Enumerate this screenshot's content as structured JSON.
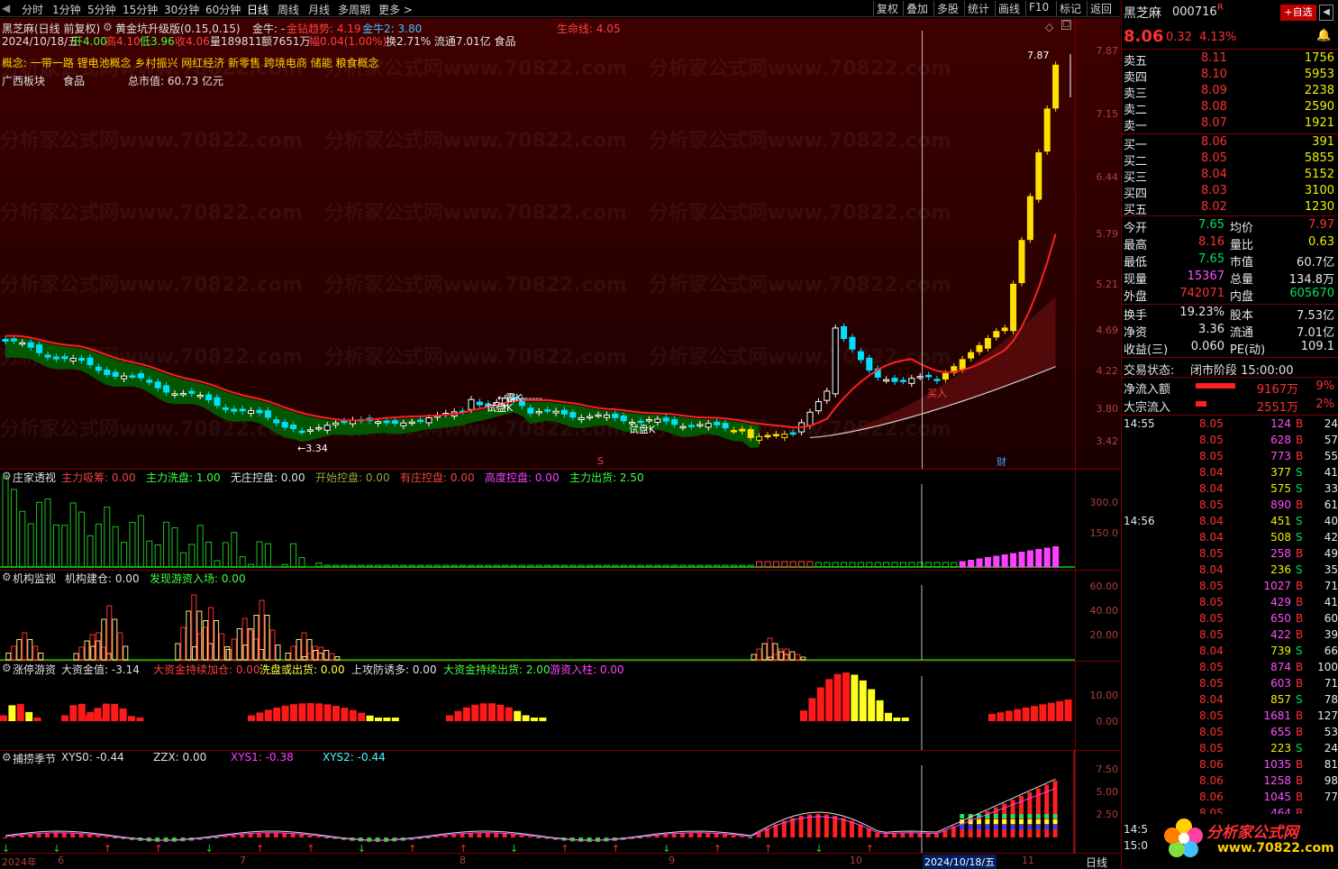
{
  "period_tabs": [
    "分时",
    "1分钟",
    "5分钟",
    "15分钟",
    "30分钟",
    "60分钟",
    "日线",
    "周线",
    "月线",
    "多周期",
    "更多 >"
  ],
  "right_tools": [
    "复权",
    "叠加",
    "多股",
    "统计",
    "画线",
    "F10",
    "标记",
    "返回"
  ],
  "header": {
    "title": "黑芝麻(日线 前复权)",
    "indicator": "黄金坑升级版(0.15,0.15)",
    "jinniu": "金牛: -",
    "jinzuan": "金钻趋势: 4.19",
    "jinniu2": "金牛2: 3.80",
    "shengming": "生命线: 4.05",
    "info_date": "2024/10/18/五",
    "info_open": "开4.00",
    "info_high": "高4.10",
    "info_low": "低3.96",
    "info_close": "收4.06",
    "info_vol": "量189811",
    "info_amt": "额7651万",
    "info_chg": "幅0.04(1.00%)",
    "info_rest": "换2.71% 流通7.01亿 食品",
    "concept": "概念: 一带一路 锂电池概念 乡村振兴 网红经济 新零售 跨境电商 储能 粮食概念",
    "board": "广西板块",
    "industry": "食品",
    "mktcap": "总市值: 60.73 亿元"
  },
  "main_axis": [
    "7.87",
    "7.15",
    "6.44",
    "5.79",
    "5.21",
    "4.69",
    "4.22",
    "3.80",
    "3.42"
  ],
  "annotations": {
    "high": "7.87",
    "low": "3.34",
    "buy": "买入",
    "k1": "霸K",
    "k2": "试盘K",
    "k3": "试盘K",
    "cai": "财",
    "s": "S"
  },
  "watermark": "分析家公式网www.70822.com",
  "panels": {
    "p1": {
      "name": "庄家透视",
      "items": [
        {
          "t": "主力吸筹: 0.00",
          "c": "#ff4040"
        },
        {
          "t": "主力洗盘: 1.00",
          "c": "#40ff40"
        },
        {
          "t": "无庄控盘: 0.00",
          "c": "#e0e0e0"
        },
        {
          "t": "开始控盘: 0.00",
          "c": "#a0a040"
        },
        {
          "t": "有庄控盘: 0.00",
          "c": "#ff4040"
        },
        {
          "t": "高度控盘: 0.00",
          "c": "#ff40ff"
        },
        {
          "t": "主力出货: 2.50",
          "c": "#40ff40"
        }
      ],
      "axis": [
        "300.0",
        "150.0"
      ]
    },
    "p2": {
      "name": "机构监视",
      "items": [
        {
          "t": "机构建仓: 0.00",
          "c": "#e0e0e0"
        },
        {
          "t": "发现游资入场: 0.00",
          "c": "#40ff40"
        }
      ],
      "axis": [
        "60.00",
        "40.00",
        "20.00"
      ]
    },
    "p3": {
      "name": "涨停游资",
      "items": [
        {
          "t": "大资金值: -3.14",
          "c": "#e0e0e0"
        },
        {
          "t": "大资金持续加仓: 0.00",
          "c": "#ff4040"
        },
        {
          "t": "洗盘或出货: 0.00",
          "c": "#ffff40"
        },
        {
          "t": "上攻防诱多: 0.00",
          "c": "#e0e0e0"
        },
        {
          "t": "大资金持续出货: 2.00",
          "c": "#40ff40"
        },
        {
          "t": "游资入柱: 0.00",
          "c": "#ff40ff"
        }
      ],
      "axis": [
        "10.00",
        "0.00"
      ]
    },
    "p4": {
      "name": "捕捞季节",
      "items": [
        {
          "t": "XYS0: -0.44",
          "c": "#e0e0e0"
        },
        {
          "t": "ZZX: 0.00",
          "c": "#e0e0e0"
        },
        {
          "t": "XYS1: -0.38",
          "c": "#ff40ff"
        },
        {
          "t": "XYS2: -0.44",
          "c": "#40ffff"
        }
      ],
      "axis": [
        "7.50",
        "5.00",
        "2.50"
      ]
    }
  },
  "xaxis": [
    "2024年",
    "6",
    "7",
    "8",
    "9",
    "10",
    "2024/10/18/五",
    "11"
  ],
  "period_label": "日线",
  "quote": {
    "name": "黑芝麻",
    "code": "000716",
    "flag": "R",
    "add_btn": "+自选",
    "price": "8.06",
    "chg": "0.32",
    "pct": "4.13%",
    "asks": [
      {
        "l": "卖五",
        "p": "8.11",
        "v": "1756"
      },
      {
        "l": "卖四",
        "p": "8.10",
        "v": "5953"
      },
      {
        "l": "卖三",
        "p": "8.09",
        "v": "2238"
      },
      {
        "l": "卖二",
        "p": "8.08",
        "v": "2590"
      },
      {
        "l": "卖一",
        "p": "8.07",
        "v": "1921"
      }
    ],
    "bids": [
      {
        "l": "买一",
        "p": "8.06",
        "v": "391"
      },
      {
        "l": "买二",
        "p": "8.05",
        "v": "5855"
      },
      {
        "l": "买三",
        "p": "8.04",
        "v": "5152"
      },
      {
        "l": "买四",
        "p": "8.03",
        "v": "3100"
      },
      {
        "l": "买五",
        "p": "8.02",
        "v": "1230"
      }
    ],
    "stats": [
      {
        "l1": "今开",
        "v1": "7.65",
        "c1": "grn",
        "l2": "均价",
        "v2": "7.97",
        "c2": "red"
      },
      {
        "l1": "最高",
        "v1": "8.16",
        "c1": "red",
        "l2": "量比",
        "v2": "0.63",
        "c2": "yel"
      },
      {
        "l1": "最低",
        "v1": "7.65",
        "c1": "grn",
        "l2": "市值",
        "v2": "60.7亿",
        "c2": "wht"
      },
      {
        "l1": "现量",
        "v1": "15367",
        "c1": "mag",
        "l2": "总量",
        "v2": "134.8万",
        "c2": "wht"
      },
      {
        "l1": "外盘",
        "v1": "742071",
        "c1": "red",
        "l2": "内盘",
        "v2": "605670",
        "c2": "grn"
      }
    ],
    "stats2": [
      {
        "l1": "换手",
        "v1": "19.23%",
        "l2": "股本",
        "v2": "7.53亿"
      },
      {
        "l1": "净资",
        "v1": "3.36",
        "l2": "流通",
        "v2": "7.01亿"
      },
      {
        "l1": "收益(三)",
        "v1": "0.060",
        "l2": "PE(动)",
        "v2": "109.1"
      }
    ],
    "status_label": "交易状态:",
    "status": "闭市阶段 15:00:00",
    "inflow": [
      {
        "l": "净流入额",
        "bar": 0.95,
        "v": "9167万",
        "p": "9%"
      },
      {
        "l": "大宗流入",
        "bar": 0.25,
        "v": "2551万",
        "p": "2%"
      }
    ],
    "ticks": [
      {
        "t": "14:55",
        "p": "8.05",
        "v": "124",
        "d": "B",
        "n": "24"
      },
      {
        "t": "",
        "p": "8.05",
        "v": "628",
        "d": "B",
        "n": "57"
      },
      {
        "t": "",
        "p": "8.05",
        "v": "773",
        "d": "B",
        "n": "55"
      },
      {
        "t": "",
        "p": "8.04",
        "v": "377",
        "d": "S",
        "n": "41"
      },
      {
        "t": "",
        "p": "8.04",
        "v": "575",
        "d": "S",
        "n": "33"
      },
      {
        "t": "",
        "p": "8.05",
        "v": "890",
        "d": "B",
        "n": "61"
      },
      {
        "t": "14:56",
        "p": "8.04",
        "v": "451",
        "d": "S",
        "n": "40"
      },
      {
        "t": "",
        "p": "8.04",
        "v": "508",
        "d": "S",
        "n": "42"
      },
      {
        "t": "",
        "p": "8.05",
        "v": "258",
        "d": "B",
        "n": "49"
      },
      {
        "t": "",
        "p": "8.04",
        "v": "236",
        "d": "S",
        "n": "35"
      },
      {
        "t": "",
        "p": "8.05",
        "v": "1027",
        "d": "B",
        "n": "71"
      },
      {
        "t": "",
        "p": "8.05",
        "v": "429",
        "d": "B",
        "n": "41"
      },
      {
        "t": "",
        "p": "8.05",
        "v": "650",
        "d": "B",
        "n": "60"
      },
      {
        "t": "",
        "p": "8.05",
        "v": "422",
        "d": "B",
        "n": "39"
      },
      {
        "t": "",
        "p": "8.04",
        "v": "739",
        "d": "S",
        "n": "66"
      },
      {
        "t": "",
        "p": "8.05",
        "v": "874",
        "d": "B",
        "n": "100"
      },
      {
        "t": "",
        "p": "8.05",
        "v": "603",
        "d": "B",
        "n": "71"
      },
      {
        "t": "",
        "p": "8.04",
        "v": "857",
        "d": "S",
        "n": "78"
      },
      {
        "t": "",
        "p": "8.05",
        "v": "1681",
        "d": "B",
        "n": "127"
      },
      {
        "t": "",
        "p": "8.05",
        "v": "655",
        "d": "B",
        "n": "53"
      },
      {
        "t": "",
        "p": "8.05",
        "v": "223",
        "d": "S",
        "n": "24"
      },
      {
        "t": "",
        "p": "8.06",
        "v": "1035",
        "d": "B",
        "n": "81"
      },
      {
        "t": "",
        "p": "8.06",
        "v": "1258",
        "d": "B",
        "n": "98"
      },
      {
        "t": "",
        "p": "8.06",
        "v": "1045",
        "d": "B",
        "n": "77"
      },
      {
        "t": "",
        "p": "8.05",
        "v": "464",
        "d": "B",
        "n": ""
      },
      {
        "t": "14:5",
        "p": "",
        "v": "",
        "d": "",
        "n": ""
      },
      {
        "t": "15:0",
        "p": "",
        "v": "",
        "d": "",
        "n": ""
      }
    ],
    "logo_text": "分析家公式网",
    "logo_url": "www.70822.com"
  }
}
